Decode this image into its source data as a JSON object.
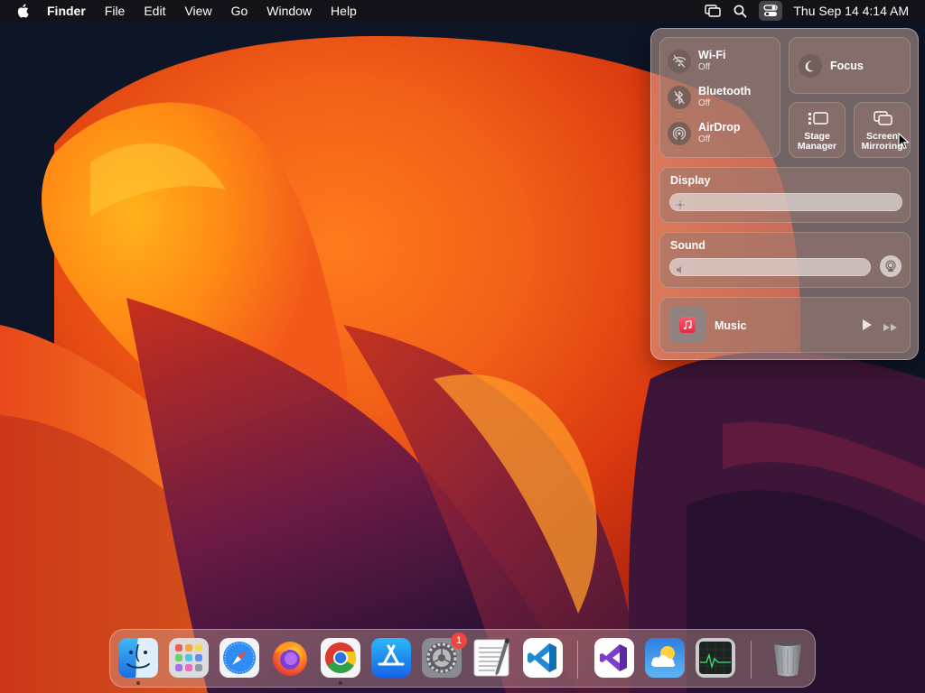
{
  "menubar": {
    "apple_icon": "apple-logo-icon",
    "app_name": "Finder",
    "menus": [
      "File",
      "Edit",
      "View",
      "Go",
      "Window",
      "Help"
    ],
    "status_icons": [
      "screen-mirroring-icon",
      "spotlight-search-icon",
      "control-center-icon"
    ],
    "clock": "Thu Sep 14  4:14 AM"
  },
  "control_center": {
    "wifi": {
      "label": "Wi-Fi",
      "status": "Off",
      "icon": "wifi-off-icon"
    },
    "bluetooth": {
      "label": "Bluetooth",
      "status": "Off",
      "icon": "bluetooth-icon"
    },
    "airdrop": {
      "label": "AirDrop",
      "status": "Off",
      "icon": "airdrop-icon"
    },
    "focus": {
      "label": "Focus",
      "icon": "moon-icon"
    },
    "stage_manager": {
      "label_line1": "Stage",
      "label_line2": "Manager",
      "icon": "stage-manager-icon"
    },
    "screen_mirroring": {
      "label_line1": "Screen",
      "label_line2": "Mirroring",
      "icon": "screen-mirroring-icon"
    },
    "display": {
      "label": "Display",
      "brightness": 0.0
    },
    "sound": {
      "label": "Sound",
      "volume": 0.0
    },
    "now_playing": {
      "app": "Music",
      "icon": "music-note-icon"
    }
  },
  "dock": {
    "apps": [
      {
        "name": "Finder",
        "icon": "finder-icon",
        "running": true
      },
      {
        "name": "Launchpad",
        "icon": "launchpad-icon",
        "running": false
      },
      {
        "name": "Safari",
        "icon": "safari-icon",
        "running": false
      },
      {
        "name": "Firefox",
        "icon": "firefox-icon",
        "running": false
      },
      {
        "name": "Google Chrome",
        "icon": "chrome-icon",
        "running": true
      },
      {
        "name": "App Store",
        "icon": "app-store-icon",
        "running": false
      },
      {
        "name": "System Settings",
        "icon": "system-settings-icon",
        "running": false,
        "badge": "1"
      },
      {
        "name": "TextEdit",
        "icon": "textedit-icon",
        "running": false
      },
      {
        "name": "Visual Studio Code",
        "icon": "vscode-icon",
        "running": false
      },
      {
        "name": "Visual Studio",
        "icon": "visual-studio-icon",
        "running": false
      },
      {
        "name": "Weather",
        "icon": "weather-icon",
        "running": false
      },
      {
        "name": "Activity Monitor",
        "icon": "activity-monitor-icon",
        "running": false
      },
      {
        "name": "Trash",
        "icon": "trash-icon",
        "running": false
      }
    ]
  },
  "colors": {
    "menubar_bg": "#141418",
    "badge": "#f0453a",
    "wallpaper_orange": "#f26a1b",
    "wallpaper_purple": "#5a1a4a",
    "wallpaper_navy": "#0c1424"
  }
}
